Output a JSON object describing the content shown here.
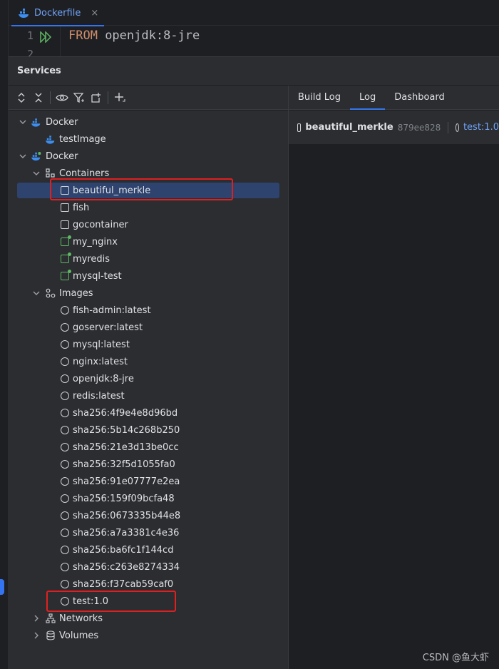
{
  "editor": {
    "tab_label": "Dockerfile",
    "tab_close": "×",
    "line_numbers": [
      "1",
      "2"
    ],
    "code_keyword": "FROM",
    "code_rest": " openjdk:8-jre"
  },
  "services": {
    "title": "Services"
  },
  "right_tabs": [
    {
      "label": "Build Log"
    },
    {
      "label": "Log"
    },
    {
      "label": "Dashboard"
    }
  ],
  "active_tab": "Log",
  "details": {
    "container_name": "beautiful_merkle",
    "container_id": "879ee828",
    "image": "test:1.0"
  },
  "tree": {
    "docker1": "Docker",
    "test_image": "testImage",
    "docker2": "Docker",
    "containers_label": "Containers",
    "containers": [
      {
        "name": "beautiful_merkle",
        "running": false
      },
      {
        "name": "fish",
        "running": false
      },
      {
        "name": "gocontainer",
        "running": false
      },
      {
        "name": "my_nginx",
        "running": true
      },
      {
        "name": "myredis",
        "running": true
      },
      {
        "name": "mysql-test",
        "running": true
      }
    ],
    "images_label": "Images",
    "images": [
      "fish-admin:latest",
      "goserver:latest",
      "mysql:latest",
      "nginx:latest",
      "openjdk:8-jre",
      "redis:latest",
      "sha256:4f9e4e8d96bd",
      "sha256:5b14c268b250",
      "sha256:21e3d13be0cc",
      "sha256:32f5d1055fa0",
      "sha256:91e07777e2ea",
      "sha256:159f09bcfa48",
      "sha256:0673335b44e8",
      "sha256:a7a3381c4e36",
      "sha256:ba6fc1f144cd",
      "sha256:c263e8274334",
      "sha256:f37cab59caf0",
      "test:1.0"
    ],
    "networks_label": "Networks",
    "volumes_label": "Volumes"
  },
  "watermark": "CSDN @鱼大虾",
  "colors": {
    "accent": "#3574f0",
    "running": "#5fb865",
    "highlight": "#e02020"
  }
}
